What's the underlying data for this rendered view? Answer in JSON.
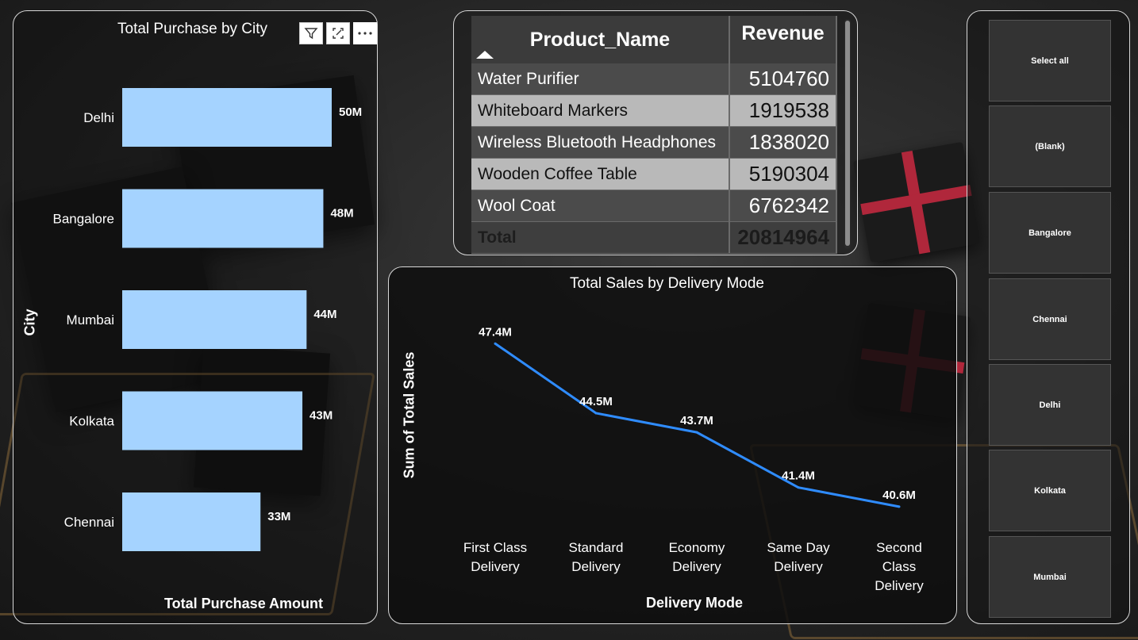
{
  "bar_chart": {
    "title": "Total Purchase by City",
    "toolbar": {
      "filter_icon": "filter-icon",
      "focus_icon": "focus-mode-icon",
      "more_icon": "more-options-icon"
    },
    "chart_data": {
      "type": "bar",
      "orientation": "horizontal",
      "categories": [
        "Delhi",
        "Bangalore",
        "Mumbai",
        "Kolkata",
        "Chennai"
      ],
      "values": [
        50,
        48,
        44,
        43,
        33
      ],
      "data_labels": [
        "50M",
        "48M",
        "44M",
        "43M",
        "33M"
      ],
      "unit": "M",
      "xlabel": "Total Purchase Amount",
      "ylabel": "City",
      "xlim": [
        0,
        60
      ],
      "color": "#a5d3ff",
      "grid": false
    }
  },
  "product_table": {
    "columns": [
      "Product_Name",
      "Revenue"
    ],
    "sort_indicator": "ascending",
    "rows": [
      {
        "name": "Water Purifier",
        "revenue": "5104760"
      },
      {
        "name": "Whiteboard Markers",
        "revenue": "1919538"
      },
      {
        "name": "Wireless Bluetooth Headphones",
        "revenue": "1838020"
      },
      {
        "name": "Wooden Coffee Table",
        "revenue": "5190304"
      },
      {
        "name": "Wool Coat",
        "revenue": "6762342"
      }
    ],
    "total_label": "Total",
    "total_value": "20814964"
  },
  "line_chart": {
    "title": "Total Sales by Delivery Mode",
    "chart_data": {
      "type": "line",
      "categories": [
        "First Class Delivery",
        "Standard Delivery",
        "Economy Delivery",
        "Same Day Delivery",
        "Second Class Delivery"
      ],
      "category_lines": [
        [
          "First Class",
          "Delivery"
        ],
        [
          "Standard",
          "Delivery"
        ],
        [
          "Economy",
          "Delivery"
        ],
        [
          "Same Day",
          "Delivery"
        ],
        [
          "Second",
          "Class",
          "Delivery"
        ]
      ],
      "values": [
        47.4,
        44.5,
        43.7,
        41.4,
        40.6
      ],
      "data_labels": [
        "47.4M",
        "44.5M",
        "43.7M",
        "41.4M",
        "40.6M"
      ],
      "unit": "M",
      "xlabel": "Delivery Mode",
      "ylabel": "Sum of Total Sales",
      "ylim": [
        40,
        48.5
      ],
      "color": "#2f8cff",
      "grid": false
    }
  },
  "city_slicer": {
    "items": [
      "Select all",
      "(Blank)",
      "Bangalore",
      "Chennai",
      "Delhi",
      "Kolkata",
      "Mumbai"
    ]
  }
}
